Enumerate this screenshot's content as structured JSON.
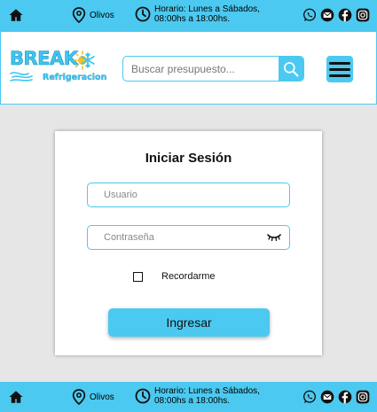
{
  "topbar": {
    "location": "Olivos",
    "hours_line1": "Horario: Lunes a Sábados,",
    "hours_line2": "08:00hs a 18:00hs.",
    "social_icons": [
      "whatsapp-icon",
      "email-icon",
      "facebook-icon",
      "instagram-icon"
    ]
  },
  "header": {
    "logo_line1": "BREAK",
    "logo_line2": "Refrigeracion",
    "search_placeholder": "Buscar presupuesto..."
  },
  "login": {
    "title": "Iniciar Sesión",
    "username_placeholder": "Usuario",
    "password_placeholder": "Contraseña",
    "remember_label": "Recordarme",
    "submit_label": "Ingresar"
  },
  "footer": {
    "location": "Olivos",
    "hours_line1": "Horario: Lunes a Sábados,",
    "hours_line2": "08:00hs a 18:00hs."
  },
  "colors": {
    "accent": "#4cc9f0",
    "background": "#e6e6e6",
    "card": "#ffffff"
  }
}
